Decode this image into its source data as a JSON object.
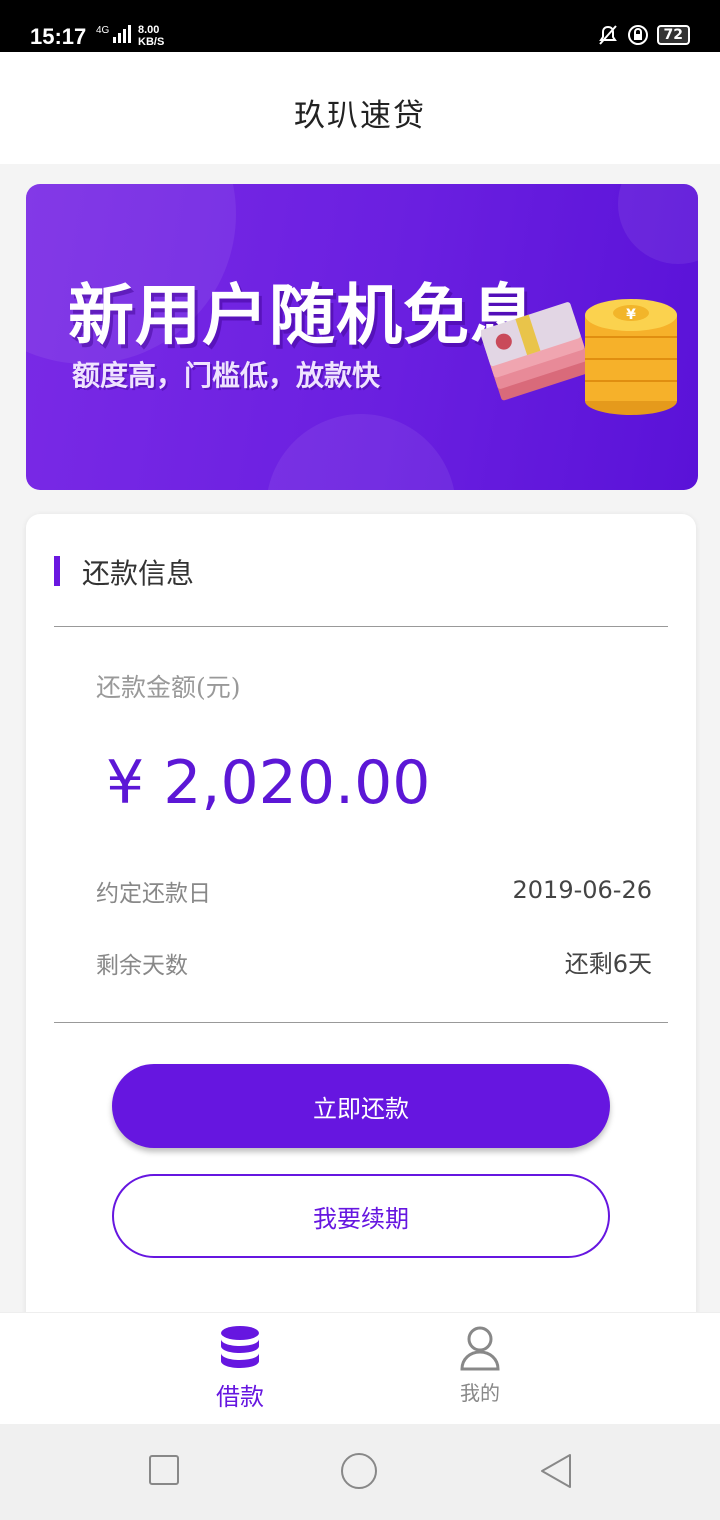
{
  "status_bar": {
    "time": "15:17",
    "network": "4G",
    "speed_value": "8.00",
    "speed_unit": "KB/S",
    "battery": "72"
  },
  "header": {
    "title": "玖玐速贷"
  },
  "banner": {
    "title": "新用户随机免息",
    "subtitle": "额度高，门槛低，放款快"
  },
  "repayment": {
    "section_title": "还款信息",
    "amount_label": "还款金额(元)",
    "amount": "¥ 2,020.00",
    "due_label": "约定还款日",
    "due_value": "2019-06-26",
    "remaining_label": "剩余天数",
    "remaining_value": "还剩6天",
    "repay_button": "立即还款",
    "renew_button": "我要续期"
  },
  "tabs": [
    {
      "label": "借款",
      "icon": "database-icon",
      "active": true
    },
    {
      "label": "我的",
      "icon": "user-icon",
      "active": false
    }
  ],
  "colors": {
    "accent": "#6616e0",
    "banner": "#6a1fe0",
    "inactive": "#888888"
  }
}
